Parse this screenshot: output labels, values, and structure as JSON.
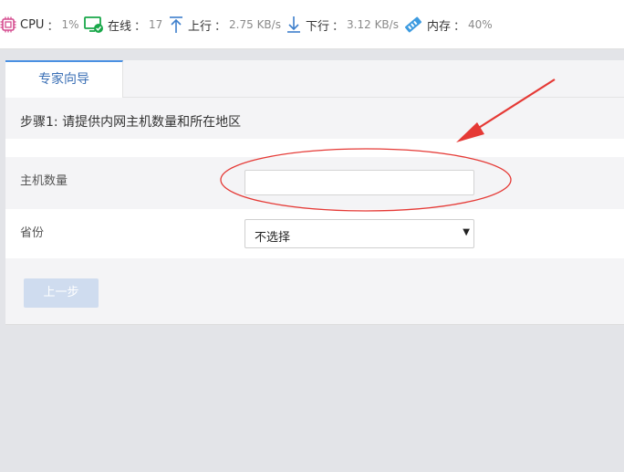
{
  "status": {
    "cpu": {
      "label": "CPU",
      "value": "1%"
    },
    "online": {
      "label": "在线",
      "value": "17"
    },
    "upload": {
      "label": "上行",
      "value": "2.75 KB/s"
    },
    "download": {
      "label": "下行",
      "value": "3.12 KB/s"
    },
    "memory": {
      "label": "内存",
      "value": "40%"
    },
    "colon": "："
  },
  "wizard": {
    "tab_label": "专家向导",
    "step_title": "步骤1: 请提供内网主机数量和所在地区",
    "host_count": {
      "label": "主机数量",
      "value": ""
    },
    "province": {
      "label": "省份",
      "selected": "不选择"
    },
    "prev_label": "上一步"
  },
  "colors": {
    "accent": "#4a90e2",
    "annotation_red": "#e53935",
    "online_green": "#1aa84a",
    "cpu_pink": "#d54c8f"
  }
}
